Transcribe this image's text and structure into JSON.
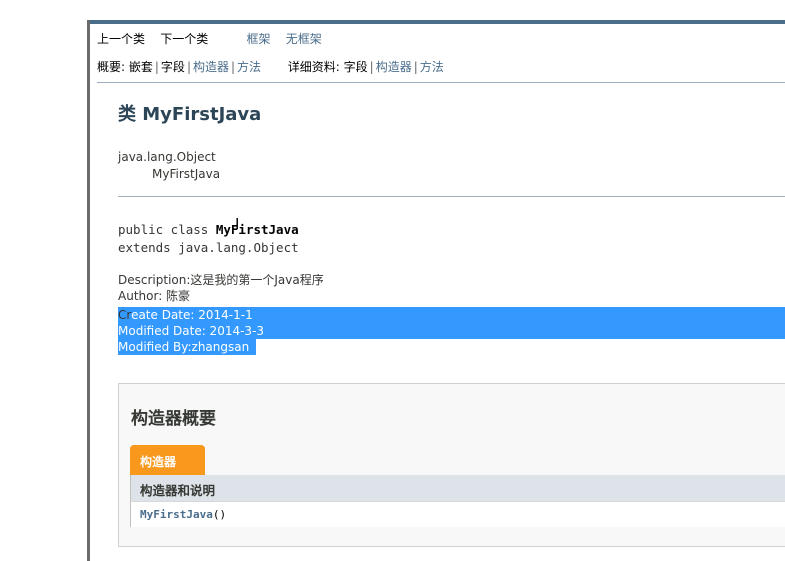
{
  "nav": {
    "prev_class": "上一个类",
    "next_class": "下一个类",
    "frames": "框架",
    "no_frames": "无框架",
    "summary_label": "概要: ",
    "summary_nested": "嵌套",
    "summary_field": "字段",
    "summary_constr": "构造器",
    "summary_method": "方法",
    "detail_label": "详细资料: ",
    "detail_field": "字段",
    "detail_constr": "构造器",
    "detail_method": "方法"
  },
  "class_info": {
    "title": "类 MyFirstJava",
    "inherit_root": "java.lang.Object",
    "inherit_child": "MyFirstJava",
    "decl_prefix": "public class ",
    "decl_name": "MyFirstJava",
    "decl_extends": "extends java.lang.Object",
    "description": "Description:这是我的第一个Java程序",
    "author": "Author: 陈豪",
    "create_prefix": "Cr",
    "create_rest": "eate Date:  2014-1-1",
    "modified_date": "Modified Date:  2014-3-3",
    "modified_by": "Modified By:zhangsan"
  },
  "constructor_summary": {
    "title": "构造器概要",
    "tab_label": "构造器",
    "col_header": "构造器和说明",
    "rows": [
      {
        "name": "MyFirstJava",
        "params": "()"
      }
    ]
  },
  "colors": {
    "selection": "#3399ff",
    "tab": "#f8981d",
    "link": "#4a6d8c"
  }
}
